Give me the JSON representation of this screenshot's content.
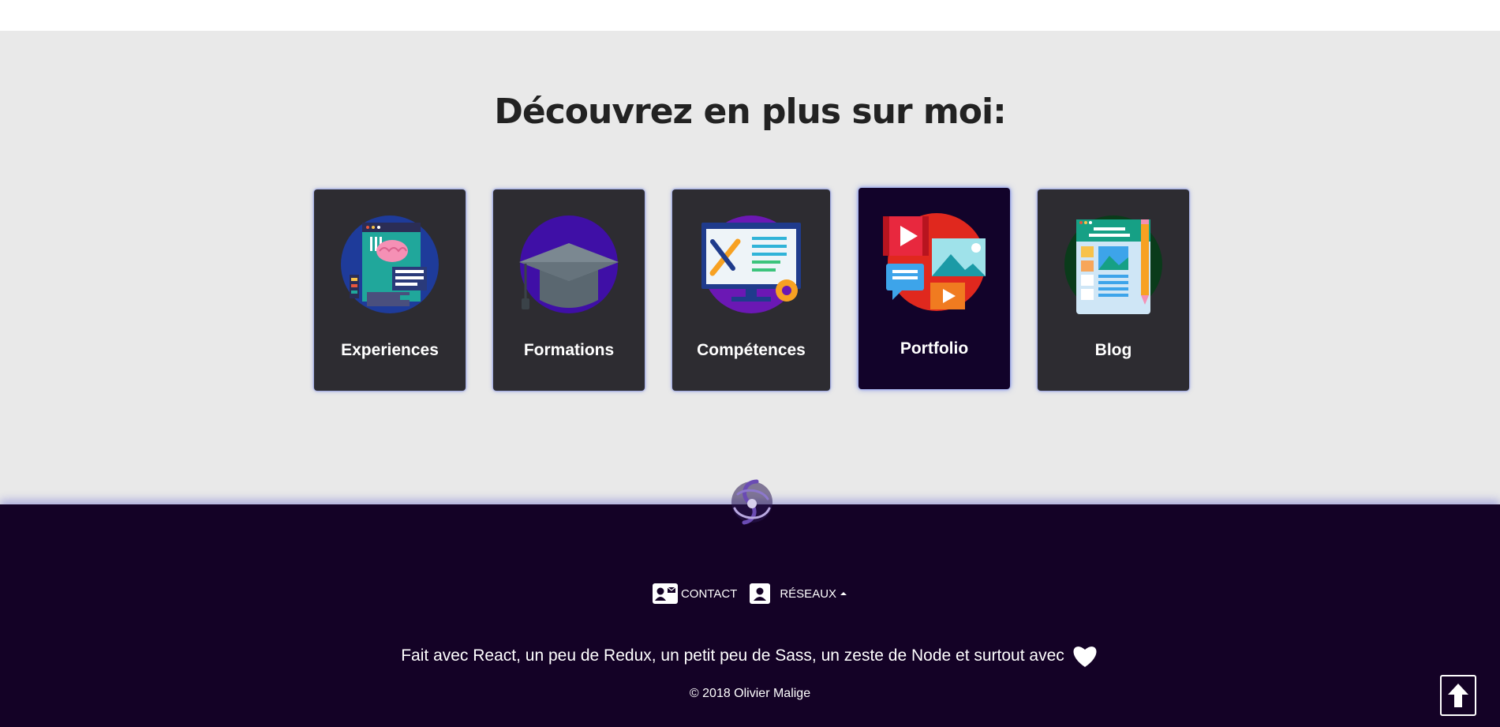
{
  "discover": {
    "title": "Découvrez en plus sur moi:",
    "cards": [
      {
        "label": "Experiences",
        "icon": "brain-computer-icon"
      },
      {
        "label": "Formations",
        "icon": "graduation-cap-icon"
      },
      {
        "label": "Compétences",
        "icon": "tools-monitor-icon"
      },
      {
        "label": "Portfolio",
        "icon": "media-portfolio-icon"
      },
      {
        "label": "Blog",
        "icon": "blog-document-icon"
      }
    ]
  },
  "footer": {
    "nav": {
      "contact": "CONTACT",
      "networks": "RÉSEAUX"
    },
    "made_with": "Fait avec React, un peu de Redux, un petit peu de Sass, un zeste de Node et surtout avec",
    "copyright": "© 2018 Olivier Malige"
  },
  "colors": {
    "page_bg": "#e9e9e9",
    "card_bg": "#2d2c31",
    "card_active_bg": "#12032a",
    "footer_bg": "#140226",
    "card_glow": "#5a6edc"
  }
}
